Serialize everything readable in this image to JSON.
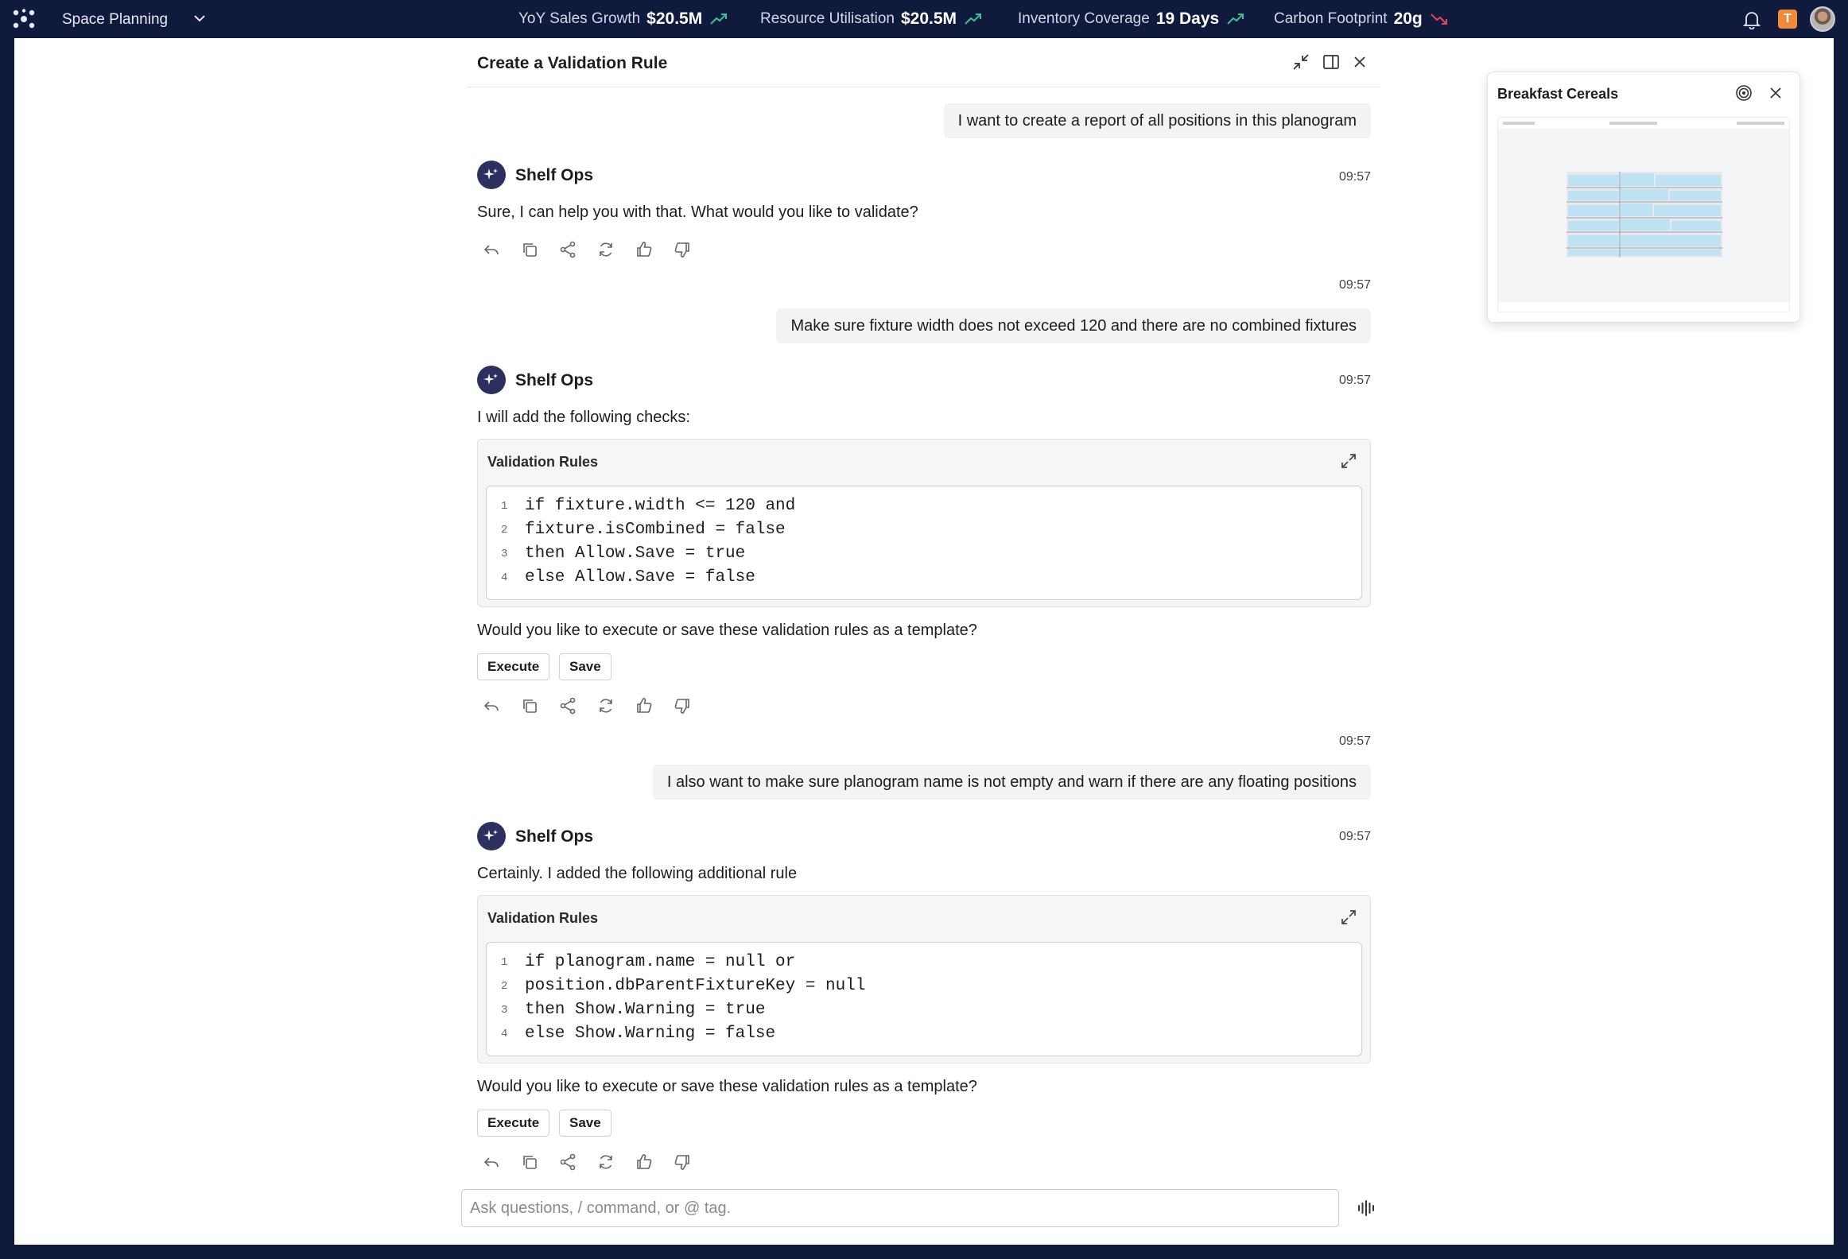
{
  "topbar": {
    "app_name": "Space Planning",
    "kpis": [
      {
        "label": "YoY Sales Growth",
        "value": "$20.5M",
        "trend": "up",
        "trend_color": "#3fbf8f"
      },
      {
        "label": "Resource Utilisation",
        "value": "$20.5M",
        "trend": "up",
        "trend_color": "#3fbf8f"
      },
      {
        "label": "Inventory Coverage",
        "value": "19 Days",
        "trend": "up",
        "trend_color": "#3fbf8f"
      },
      {
        "label": "Carbon Footprint",
        "value": "20g",
        "trend": "down",
        "trend_color": "#e0475b"
      }
    ],
    "user_initial": "T",
    "icons": [
      "app-logo-icon",
      "chevron-down-icon",
      "bell-icon"
    ]
  },
  "chat": {
    "title": "Create a Validation Rule",
    "header_icons": [
      "collapse-icon",
      "side-panel-icon",
      "close-icon"
    ],
    "bot_name": "Shelf Ops",
    "messages": [
      {
        "role": "user",
        "text": "I want to create a report of all positions in this planogram"
      },
      {
        "role": "bot",
        "time": "09:57",
        "text": "Sure, I can help you with that. What would you like to validate?"
      },
      {
        "role": "user",
        "time": "09:57",
        "text": "Make sure fixture width does not exceed 120 and there are no combined fixtures"
      },
      {
        "role": "bot",
        "time": "09:57",
        "text": "I will add the following checks:",
        "code_title": "Validation Rules",
        "code": [
          "if fixture.width <= 120 and",
          "fixture.isCombined = false",
          "then Allow.Save = true",
          "else Allow.Save = false"
        ],
        "followup": "Would you like to execute or save these validation rules as a template?",
        "buttons": [
          "Execute",
          "Save"
        ]
      },
      {
        "role": "user",
        "time": "09:57",
        "text": "I also want to make sure planogram name is not empty and warn if there are any floating positions"
      },
      {
        "role": "bot",
        "time": "09:57",
        "text": "Certainly. I added the following additional rule",
        "code_title": "Validation Rules",
        "code": [
          "if planogram.name = null or",
          "position.dbParentFixtureKey = null",
          "then Show.Warning = true",
          "else Show.Warning = false"
        ],
        "followup": "Would you like to execute or save these validation rules as a template?",
        "buttons": [
          "Execute",
          "Save"
        ]
      }
    ],
    "line_numbers": [
      "1",
      "2",
      "3",
      "4"
    ],
    "action_icons": [
      "reply-icon",
      "copy-icon",
      "share-icon",
      "regenerate-icon",
      "thumbs-up-icon",
      "thumbs-down-icon"
    ],
    "input_placeholder": "Ask questions, / command, or @ tag.",
    "input_value": ""
  },
  "preview": {
    "title": "Breakfast Cereals",
    "icons": [
      "target-icon",
      "close-icon"
    ]
  },
  "colors": {
    "topbar_bg": "#0f1a3d",
    "bot_avatar": "#2d2f5e",
    "user_badge": "#f08a3a",
    "shelf_blue": "#bfe3f3"
  }
}
